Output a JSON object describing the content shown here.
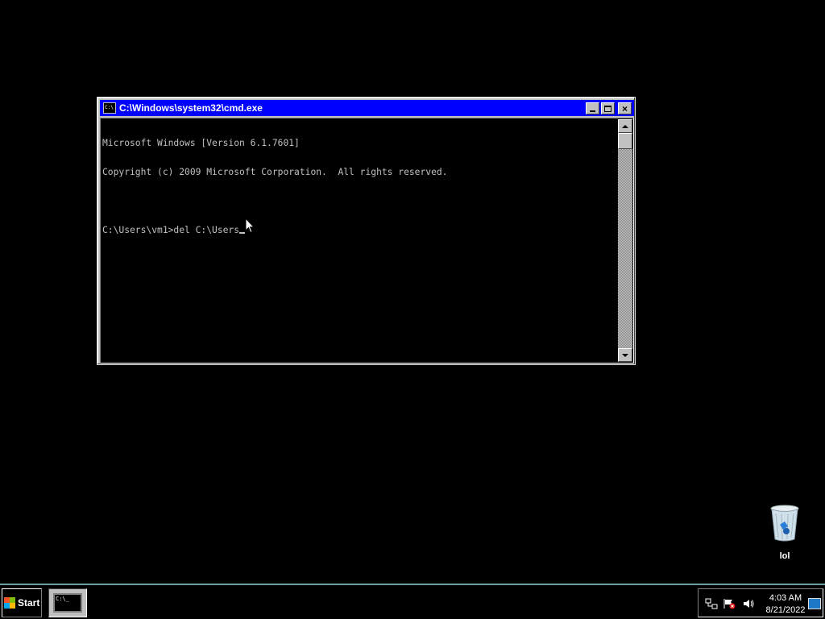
{
  "window": {
    "title": "C:\\Windows\\system32\\cmd.exe",
    "icon_text": "C:\\",
    "buttons": {
      "minimize": "minimize-icon",
      "maximize": "maximize-icon",
      "close": "×"
    }
  },
  "console": {
    "lines": [
      "Microsoft Windows [Version 6.1.7601]",
      "Copyright (c) 2009 Microsoft Corporation.  All rights reserved.",
      "",
      "C:\\Users\\vm1>del C:\\Users"
    ]
  },
  "desktop": {
    "icons": [
      {
        "label": "lol",
        "icon": "recycle-bin-icon"
      }
    ]
  },
  "taskbar": {
    "start_label": "Start",
    "task_button_text": "C:\\_",
    "clock_time": "4:03 AM",
    "clock_date": "8/21/2022",
    "tray_icons": [
      "network-icon",
      "action-center-flag-icon",
      "volume-icon"
    ]
  },
  "colors": {
    "titlebar": "#0000ff",
    "console_bg": "#000000",
    "console_text": "#c0c0c0",
    "taskbar_border": "#6fa0a0"
  }
}
